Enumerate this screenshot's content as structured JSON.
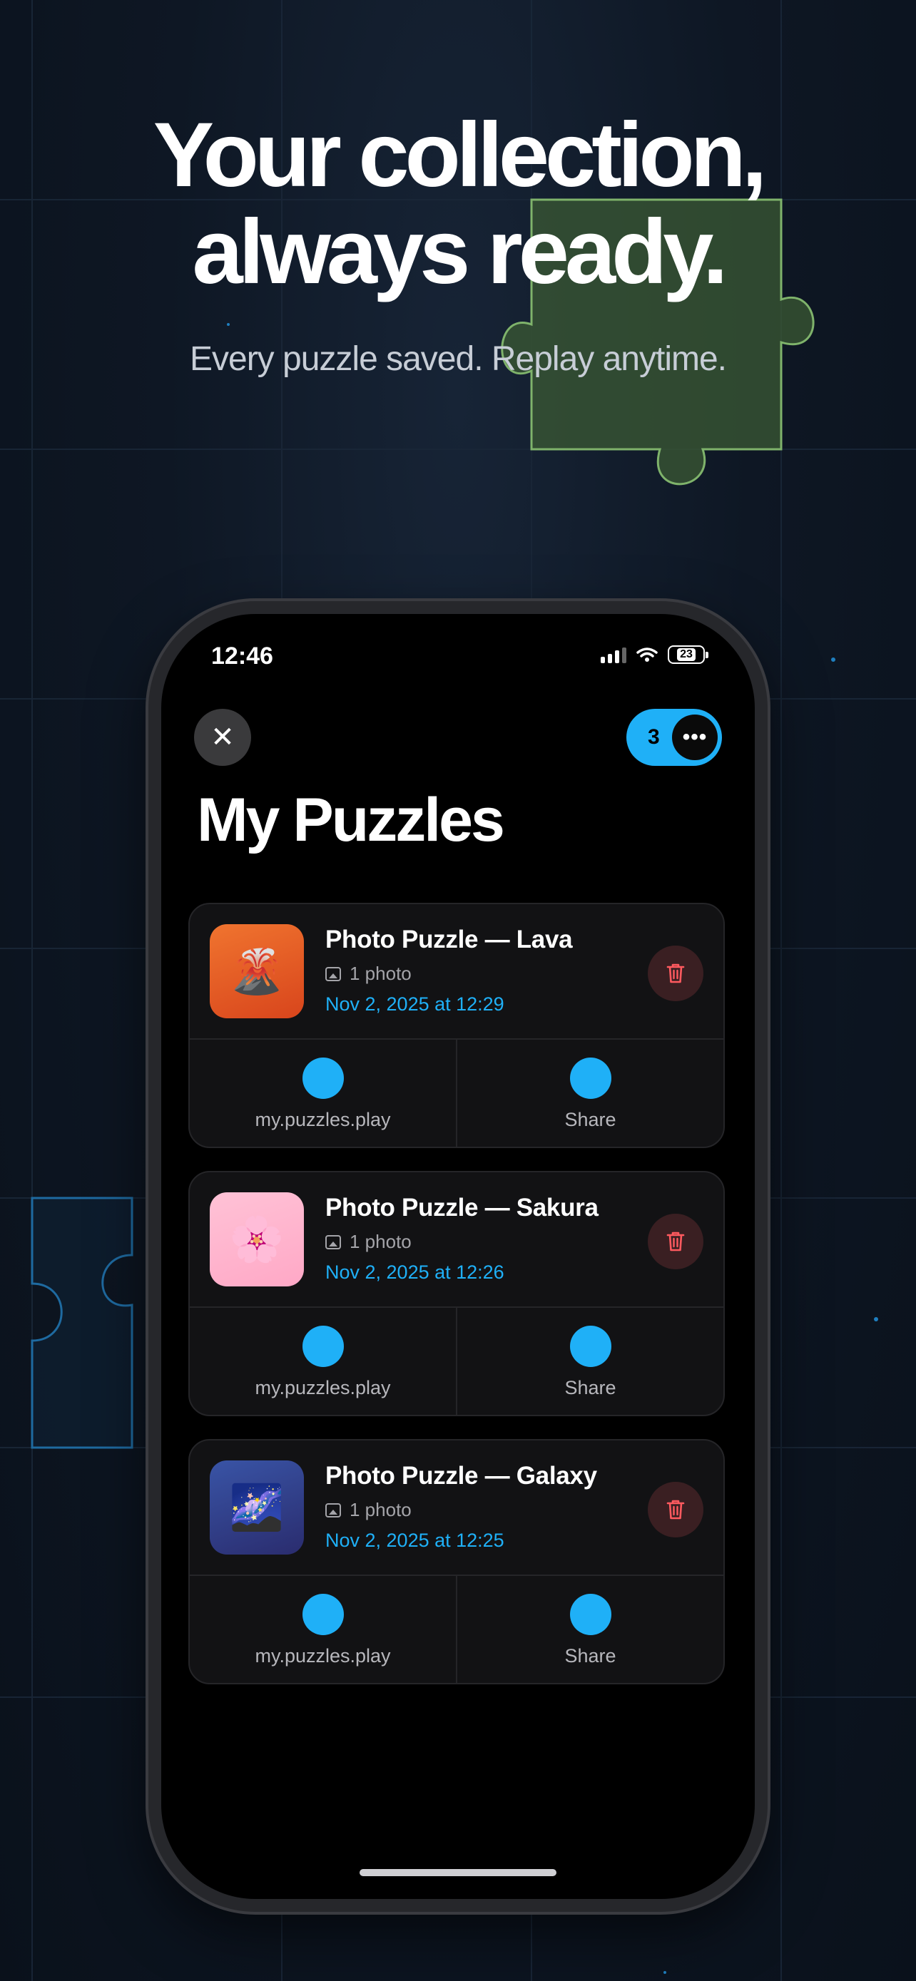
{
  "hero": {
    "line1": "Your collection,",
    "line2": "always ready.",
    "subtitle": "Every puzzle saved. Replay anytime."
  },
  "status_bar": {
    "time": "12:46",
    "battery": "23"
  },
  "header": {
    "close_icon": "✕",
    "puzzle_count": "3",
    "more_icon": "•••",
    "title": "My Puzzles"
  },
  "colors": {
    "accent": "#1fb0f7",
    "delete": "#ff5a5f",
    "background": "#000000"
  },
  "puzzles": [
    {
      "title": "Photo Puzzle — Lava",
      "photos": "1 photo",
      "date": "Nov 2, 2025 at 12:29",
      "thumb": "🌋",
      "play_label": "my.puzzles.play",
      "share_label": "Share"
    },
    {
      "title": "Photo Puzzle — Sakura",
      "photos": "1 photo",
      "date": "Nov 2, 2025 at 12:26",
      "thumb": "🌸",
      "play_label": "my.puzzles.play",
      "share_label": "Share"
    },
    {
      "title": "Photo Puzzle — Galaxy",
      "photos": "1 photo",
      "date": "Nov 2, 2025 at 12:25",
      "thumb": "🌌",
      "play_label": "my.puzzles.play",
      "share_label": "Share"
    }
  ]
}
